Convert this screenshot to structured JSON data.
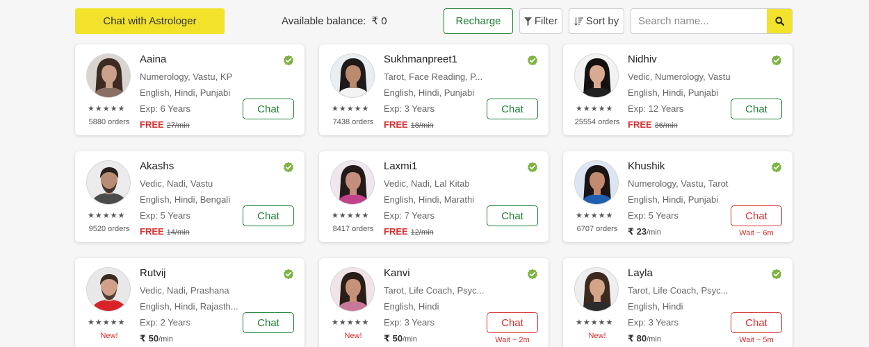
{
  "toolbar": {
    "chat_with_astrologer": "Chat with Astrologer",
    "balance_label": "Available balance:",
    "balance_value": "₹ 0",
    "recharge": "Recharge",
    "filter": "Filter",
    "sort": "Sort by",
    "search_placeholder": "Search name..."
  },
  "colors": {
    "accent_yellow": "#f2e22c",
    "green": "#1e7e34",
    "red": "#d32f2f",
    "verified": "#7cb342"
  },
  "stars": "★★★★★",
  "astrologers": [
    {
      "name": "Aaina",
      "skills": "Numerology, Vastu, KP",
      "languages": "English, Hindi, Punjabi",
      "experience": "Exp: 6 Years",
      "orders": "5880 orders",
      "new_label": "",
      "price_free": "FREE",
      "price_original": "27/min",
      "price_current": "",
      "price_per": "",
      "chat": "Chat",
      "wait": "",
      "avatar": "woman-avatar",
      "hair": "#3b2b22",
      "skin": "#caa08a",
      "shirt": "#8a7064",
      "bg": "#d9d4cf"
    },
    {
      "name": "Sukhmanpreet1",
      "skills": "Tarot, Face Reading, P...",
      "languages": "English, Hindi, Punjabi",
      "experience": "Exp: 3 Years",
      "orders": "7438 orders",
      "new_label": "",
      "price_free": "FREE",
      "price_original": "18/min",
      "price_current": "",
      "price_per": "",
      "chat": "Chat",
      "wait": "",
      "avatar": "woman-avatar",
      "hair": "#1e1a1a",
      "skin": "#b98a6c",
      "shirt": "#f3f3f3",
      "bg": "#e9eef3"
    },
    {
      "name": "Nidhiv",
      "skills": "Vedic, Numerology, Vastu",
      "languages": "English, Hindi, Punjabi",
      "experience": "Exp: 12 Years",
      "orders": "25554 orders",
      "new_label": "",
      "price_free": "FREE",
      "price_original": "36/min",
      "price_current": "",
      "price_per": "",
      "chat": "Chat",
      "wait": "",
      "avatar": "woman-avatar",
      "hair": "#151111",
      "skin": "#d8aa92",
      "shirt": "#202020",
      "bg": "#f2f2f2"
    },
    {
      "name": "Akashs",
      "skills": "Vedic, Nadi, Vastu",
      "languages": "English, Hindi, Bengali",
      "experience": "Exp: 5 Years",
      "orders": "9520 orders",
      "new_label": "",
      "price_free": "FREE",
      "price_original": "14/min",
      "price_current": "",
      "price_per": "",
      "chat": "Chat",
      "wait": "",
      "avatar": "man-avatar",
      "hair": "#2a211c",
      "skin": "#b88c74",
      "shirt": "#4b4b4b",
      "bg": "#ebebeb"
    },
    {
      "name": "Laxmi1",
      "skills": "Vedic, Nadi, Lal Kitab",
      "languages": "English, Hindi, Marathi",
      "experience": "Exp: 7 Years",
      "orders": "8417 orders",
      "new_label": "",
      "price_free": "FREE",
      "price_original": "12/min",
      "price_current": "",
      "price_per": "",
      "chat": "Chat",
      "wait": "",
      "avatar": "woman-avatar",
      "hair": "#231a1a",
      "skin": "#c58e7c",
      "shirt": "#c2418c",
      "bg": "#efe6ee"
    },
    {
      "name": "Khushik",
      "skills": "Numerology, Vastu, Tarot",
      "languages": "English, Hindi, Punjabi",
      "experience": "Exp: 5 Years",
      "orders": "6707 orders",
      "new_label": "",
      "price_free": "",
      "price_original": "",
      "price_current": "₹ 23",
      "price_per": "/min",
      "chat": "Chat",
      "wait": "Wait ~ 6m",
      "avatar": "woman-avatar",
      "hair": "#1a1414",
      "skin": "#c28a6e",
      "shirt": "#1f5fb0",
      "bg": "#dce6f2"
    },
    {
      "name": "Rutvij",
      "skills": "Vedic, Nadi, Prashana",
      "languages": "English, Hindi, Rajasth...",
      "experience": "Exp: 2 Years",
      "orders": "",
      "new_label": "New!",
      "price_free": "",
      "price_original": "",
      "price_current": "₹ 50",
      "price_per": "/min",
      "chat": "Chat",
      "wait": "",
      "avatar": "man-avatar",
      "hair": "#3a2a20",
      "skin": "#d0a088",
      "shirt": "#d8232a",
      "bg": "#e8e8e8"
    },
    {
      "name": "Kanvi",
      "skills": "Tarot, Life Coach, Psyc...",
      "languages": "English, Hindi",
      "experience": "Exp: 3 Years",
      "orders": "",
      "new_label": "New!",
      "price_free": "",
      "price_original": "",
      "price_current": "₹ 50",
      "price_per": "/min",
      "chat": "Chat",
      "wait": "Wait ~ 2m",
      "avatar": "woman-avatar",
      "hair": "#2b1d17",
      "skin": "#c79378",
      "shirt": "#c87898",
      "bg": "#f1e4e8"
    },
    {
      "name": "Layla",
      "skills": "Tarot, Life Coach, Psyc...",
      "languages": "English, Hindi",
      "experience": "Exp: 3 Years",
      "orders": "",
      "new_label": "New!",
      "price_free": "",
      "price_original": "",
      "price_current": "₹ 80",
      "price_per": "/min",
      "chat": "Chat",
      "wait": "Wait ~ 5m",
      "avatar": "woman-avatar",
      "hair": "#3d2a1e",
      "skin": "#d3a48a",
      "shirt": "#2c2c2c",
      "bg": "#eeeeee"
    }
  ]
}
